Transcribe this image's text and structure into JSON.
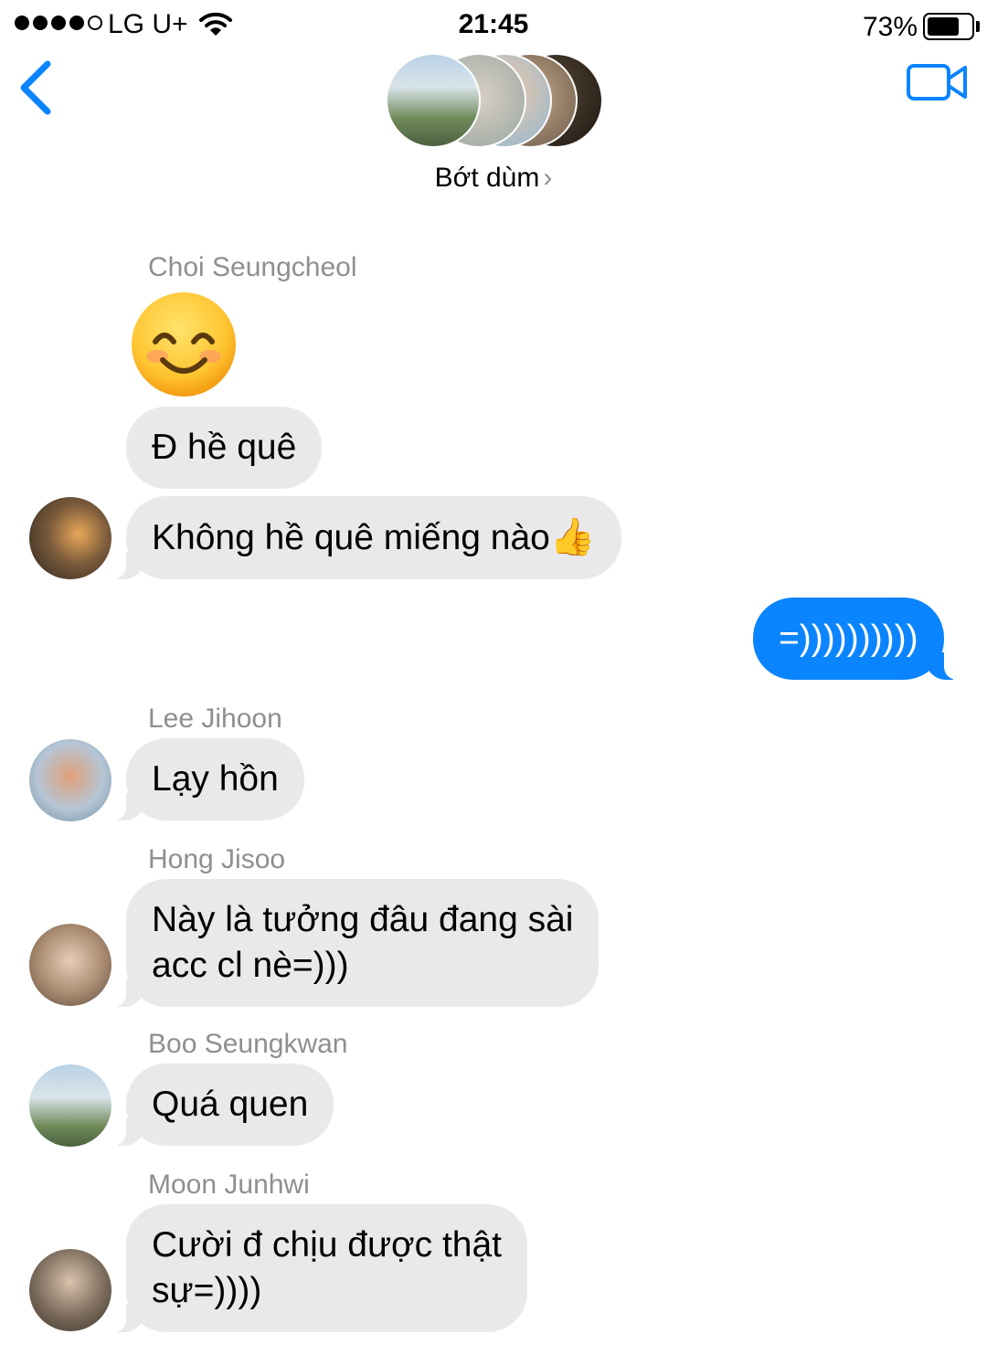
{
  "status_bar": {
    "carrier": "LG U+",
    "time": "21:45",
    "battery_percent": "73%",
    "battery_level": 0.73,
    "signal_bars": 4,
    "signal_total": 5
  },
  "header": {
    "title": "Bớt dùm",
    "chevron": "›",
    "back_icon": "chevron-left-icon",
    "video_icon": "video-camera-icon"
  },
  "colors": {
    "accent": "#0a84ff",
    "incoming_bubble": "#e9e9eb",
    "sender_name": "#8e8e93"
  },
  "messages": [
    {
      "sender": "Choi Seungcheol",
      "emoji": "smiling-face-with-smiling-eyes",
      "text1": "Đ hề quê",
      "text2": "Không hề quê miếng nào",
      "text2_emoji": "👍"
    },
    {
      "outgoing_text": "=))))))))))"
    },
    {
      "sender": "Lee Jihoon",
      "text": "Lạy hồn"
    },
    {
      "sender": "Hong Jisoo",
      "text": "Này là tưởng đâu đang sài\nacc cl nè=)))"
    },
    {
      "sender": "Boo Seungkwan",
      "text": "Quá quen"
    },
    {
      "sender": "Moon Junhwi",
      "text": "Cười đ chịu được thật\nsự=))))"
    }
  ]
}
